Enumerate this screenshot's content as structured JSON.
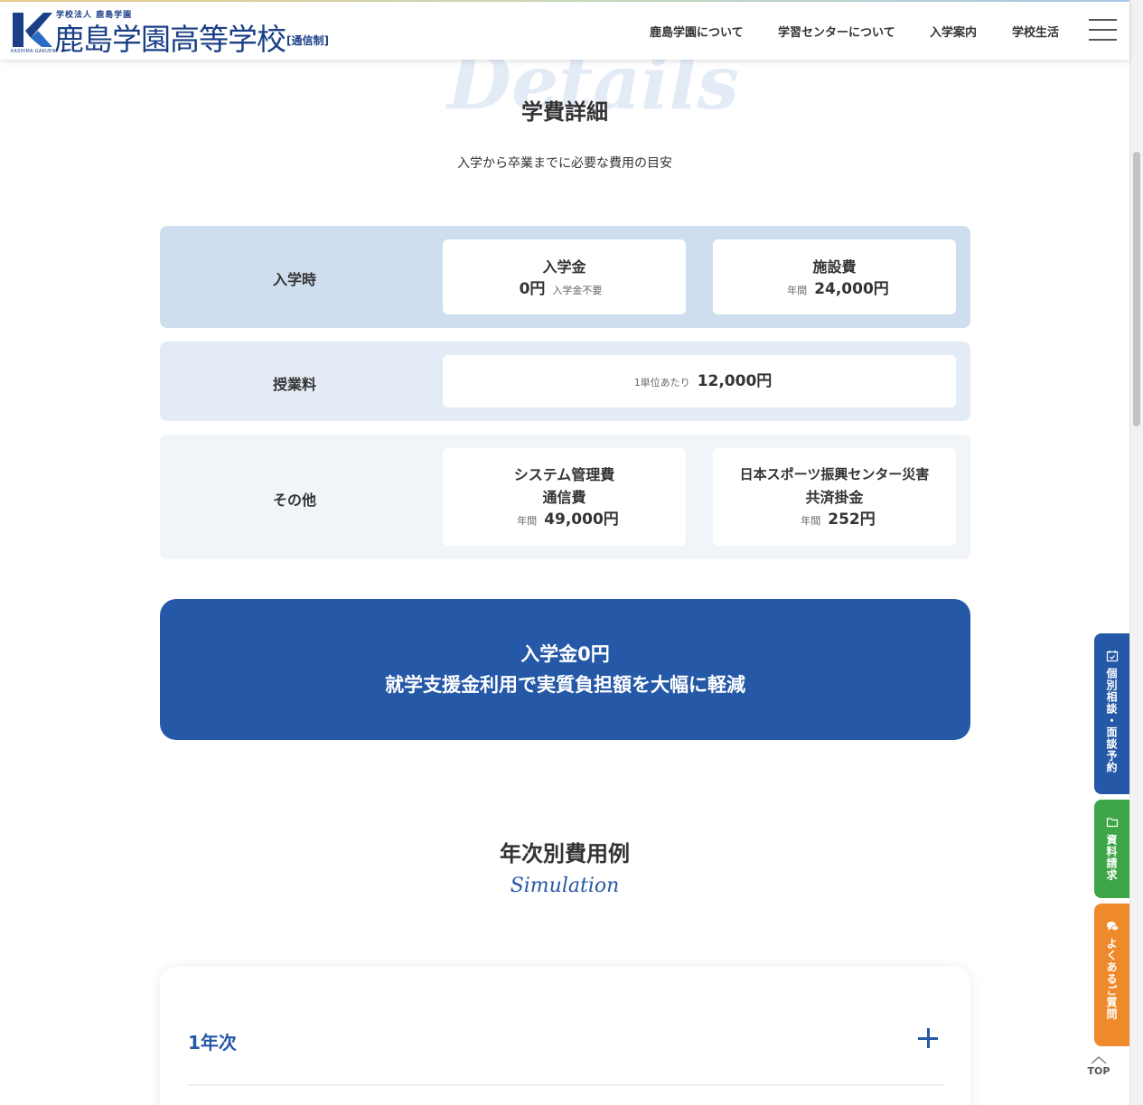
{
  "header": {
    "logo_sub": "学校法人 鹿島学園",
    "logo_main": "鹿島学園高等学校",
    "logo_tag": "[通信制]",
    "logo_kana": "KASHIMA GAKUEN",
    "nav": [
      "鹿島学園について",
      "学習センターについて",
      "入学案内",
      "学校生活"
    ]
  },
  "details": {
    "bg_word": "Details",
    "title": "学費詳細",
    "subtitle": "入学から卒業までに必要な費用の目安"
  },
  "fees": {
    "admission": {
      "label": "入学時",
      "entry_fee": {
        "name": "入学金",
        "price": "0円",
        "note": "入学金不要"
      },
      "facility_fee": {
        "name": "施設費",
        "prefix": "年間",
        "price": "24,000円"
      }
    },
    "tuition": {
      "label": "授業料",
      "prefix": "1単位あたり",
      "price": "12,000円"
    },
    "other": {
      "label": "その他",
      "system_fee": {
        "name1": "システム管理費",
        "name2": "通信費",
        "prefix": "年間",
        "price": "49,000円"
      },
      "sports_fee": {
        "name1": "日本スポーツ振興センター災害",
        "name2": "共済掛金",
        "prefix": "年間",
        "price": "252円"
      }
    }
  },
  "banner": {
    "line1": "入学金0円",
    "line2": "就学支援金利用で実質負担額を大幅に軽減"
  },
  "simulation": {
    "title": "年次別費用例",
    "script": "Simulation",
    "first_item": "1年次"
  },
  "side_tabs": {
    "consult": "個別相談・面談予約",
    "request": "資料請求",
    "faq": "よくあるご質問",
    "top": "TOP"
  },
  "colors": {
    "brand_blue": "#2558a6",
    "consult_tab": "#2558a6",
    "request_tab": "#3fa648",
    "faq_tab": "#ef8a2c"
  }
}
